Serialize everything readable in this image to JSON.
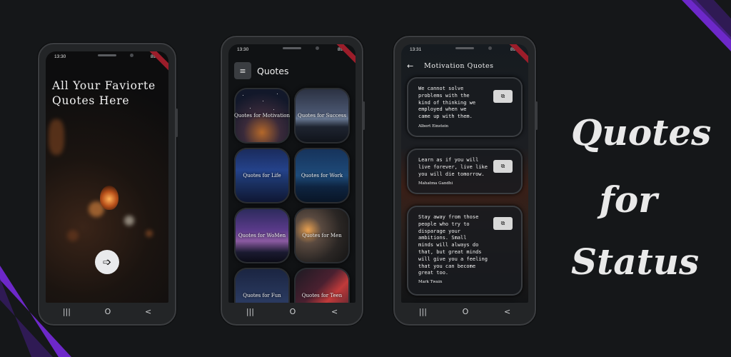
{
  "colors": {
    "background": "#151719",
    "accent_stripe": "#7b2fd6",
    "ribbon": "#9c1d2a"
  },
  "promo": {
    "line1": "Quotes",
    "line2": "for",
    "line3": "Status"
  },
  "phone1": {
    "status": {
      "time": "13:30",
      "battery": "89%"
    },
    "headline": {
      "line1": "All Your Faviorte",
      "line2": "Quotes Here"
    },
    "next_icon": "➩",
    "nav": {
      "recent": "|||",
      "home": "O",
      "back": "<"
    }
  },
  "phone2": {
    "status": {
      "time": "13:30",
      "battery": "89%"
    },
    "menu_icon": "≡",
    "title": "Quotes",
    "categories": [
      {
        "label": "Quotes for Motivation"
      },
      {
        "label": "Quotes for Success"
      },
      {
        "label": "Quotes for Life"
      },
      {
        "label": "Quotes for Work"
      },
      {
        "label": "Quotes for WoMen"
      },
      {
        "label": "Quotes for Men"
      },
      {
        "label": "Quotes for Fun"
      },
      {
        "label": "Quotes for Teen"
      }
    ],
    "nav": {
      "recent": "|||",
      "home": "O",
      "back": "<"
    }
  },
  "phone3": {
    "status": {
      "time": "13:31",
      "battery": "89%"
    },
    "back_icon": "←",
    "title": "Motivation Quotes",
    "copy_icon": "⧉",
    "quotes": [
      {
        "lines": [
          "We cannot solve",
          "problems with the",
          "kind of thinking we",
          "employed when we",
          "came up with them."
        ],
        "author": "Albert Einstein"
      },
      {
        "lines": [
          "Learn as if you will",
          "live forever, live like",
          "you will die tomorrow."
        ],
        "author": "Mahatma Gandhi"
      },
      {
        "lines": [
          "Stay away from those",
          "people who try to",
          "disparage your",
          "ambitions. Small",
          "minds will always do",
          "that, but great minds",
          "will give you a feeling",
          "that you can become",
          "great too."
        ],
        "author": "Mark Twain"
      }
    ],
    "nav": {
      "recent": "|||",
      "home": "O",
      "back": "<"
    }
  }
}
